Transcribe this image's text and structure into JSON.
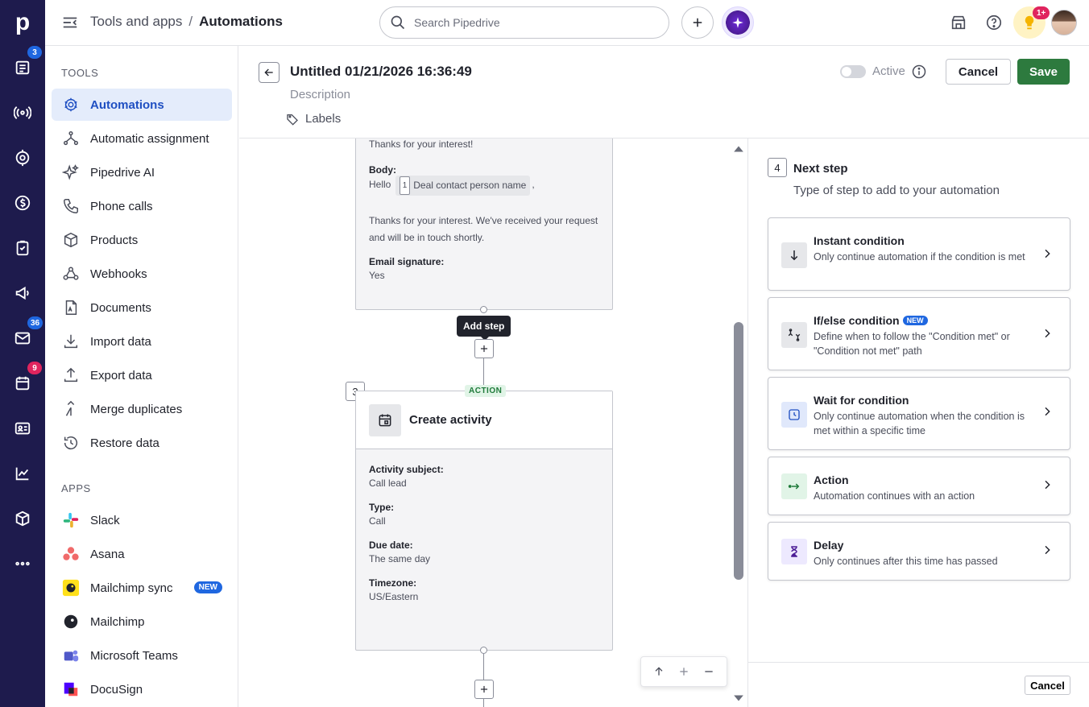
{
  "app": {
    "logo_letter": "p"
  },
  "rail": {
    "badges": {
      "leads": "3",
      "mail": "36",
      "activities": "9"
    }
  },
  "topbar": {
    "breadcrumb": {
      "parent": "Tools and apps",
      "separator": "/",
      "current": "Automations"
    },
    "search_placeholder": "Search Pipedrive",
    "notifications_badge": "1+"
  },
  "sidebar": {
    "tools_title": "TOOLS",
    "tools": [
      {
        "label": "Automations",
        "icon": "automation-icon",
        "active": true
      },
      {
        "label": "Automatic assignment",
        "icon": "assignment-icon"
      },
      {
        "label": "Pipedrive AI",
        "icon": "sparkle-icon"
      },
      {
        "label": "Phone calls",
        "icon": "phone-icon"
      },
      {
        "label": "Products",
        "icon": "box-icon"
      },
      {
        "label": "Webhooks",
        "icon": "webhook-icon"
      },
      {
        "label": "Documents",
        "icon": "document-icon"
      },
      {
        "label": "Import data",
        "icon": "import-icon"
      },
      {
        "label": "Export data",
        "icon": "export-icon"
      },
      {
        "label": "Merge duplicates",
        "icon": "merge-icon"
      },
      {
        "label": "Restore data",
        "icon": "restore-icon"
      }
    ],
    "apps_title": "APPS",
    "apps": [
      {
        "label": "Slack",
        "icon": "slack-icon"
      },
      {
        "label": "Asana",
        "icon": "asana-icon"
      },
      {
        "label": "Mailchimp sync",
        "icon": "mailchimp-icon",
        "badge": "NEW"
      },
      {
        "label": "Mailchimp",
        "icon": "mailchimp-icon"
      },
      {
        "label": "Microsoft Teams",
        "icon": "teams-icon"
      },
      {
        "label": "DocuSign",
        "icon": "docusign-icon"
      }
    ]
  },
  "editor": {
    "title": "Untitled 01/21/2026 16:36:49",
    "description_placeholder": "Description",
    "labels": "Labels",
    "active_label": "Active",
    "active": false,
    "cancel": "Cancel",
    "save": "Save"
  },
  "canvas": {
    "email_card": {
      "subject_tail": "Thanks for your interest!",
      "body_label": "Body:",
      "body_greeting": "Hello",
      "chip_num": "1",
      "chip_text": "Deal contact person name",
      "body_comma": ",",
      "body_text": "Thanks for your interest. We've received your request and will be in touch shortly.",
      "signature_label": "Email signature:",
      "signature_value": "Yes"
    },
    "tooltip": "Add step",
    "step3": {
      "number": "3",
      "tag": "ACTION",
      "name": "Create activity",
      "fields": [
        {
          "label": "Activity subject:",
          "value": "Call lead"
        },
        {
          "label": "Type:",
          "value": "Call"
        },
        {
          "label": "Due date:",
          "value": "The same day"
        },
        {
          "label": "Timezone:",
          "value": "US/Eastern"
        }
      ]
    }
  },
  "panel": {
    "step_number": "4",
    "title": "Next step",
    "subtitle": "Type of step to add to your automation",
    "options": [
      {
        "title": "Instant condition",
        "desc": "Only continue automation if the condition is met",
        "icon": "arrow-down-icon"
      },
      {
        "title": "If/else condition",
        "badge": "NEW",
        "desc": "Define when to follow the \"Condition met\" or \"Condition not met\" path",
        "icon": "branch-icon"
      },
      {
        "title": "Wait for condition",
        "desc": "Only continue automation when the condition is met within a specific time",
        "icon": "clock-icon"
      },
      {
        "title": "Action",
        "desc": "Automation continues with an action",
        "icon": "action-arrow-icon"
      },
      {
        "title": "Delay",
        "desc": "Only continues after this time has passed",
        "icon": "hourglass-icon"
      }
    ],
    "footer_cancel": "Cancel"
  },
  "colors": {
    "rail": "#1e1b4d",
    "accent": "#1f4fc2",
    "save": "#2d7a3e"
  }
}
